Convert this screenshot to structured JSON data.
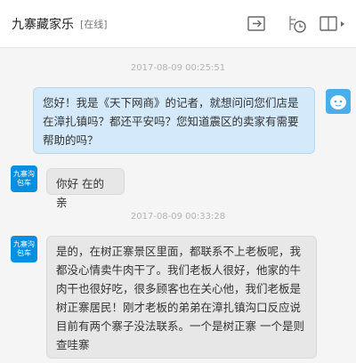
{
  "header": {
    "title": "九寨藏家乐",
    "status": "[在线]",
    "icons": [
      "forward-icon",
      "clock-icon",
      "window-panel-icon"
    ]
  },
  "messages": [
    {
      "type": "timestamp",
      "text": "2017-08-09 00:25:51"
    },
    {
      "type": "outgoing",
      "text": "您好！我是《天下网商》的记者，就想问问您们店是在漳扎镇吗？都还平安吗？您知道震区的卖家有需要帮助的吗？"
    },
    {
      "type": "incoming",
      "avatar": "九寨沟包车",
      "text": "你好 在的 亲"
    },
    {
      "type": "timestamp",
      "text": "2017-08-09 00:33:28"
    },
    {
      "type": "incoming",
      "avatar": "九寨沟包车",
      "text": "是的，在树正寨景区里面，都联系不上老板呢，我都没心情卖牛肉干了。我们老板人很好，他家的牛肉干也很好吃，很多顾客也在关心他，我们老板是树正寨居民！刚才老板的弟弟在漳扎镇沟口反应说目前有两个寨子没法联系。一个是树正寨  一个是则查哇寨"
    }
  ],
  "colors": {
    "outgoing_bubble": "#d4e9f9",
    "incoming_bubble": "#e7e7e7",
    "avatar_bg": "#0a8fe0"
  }
}
